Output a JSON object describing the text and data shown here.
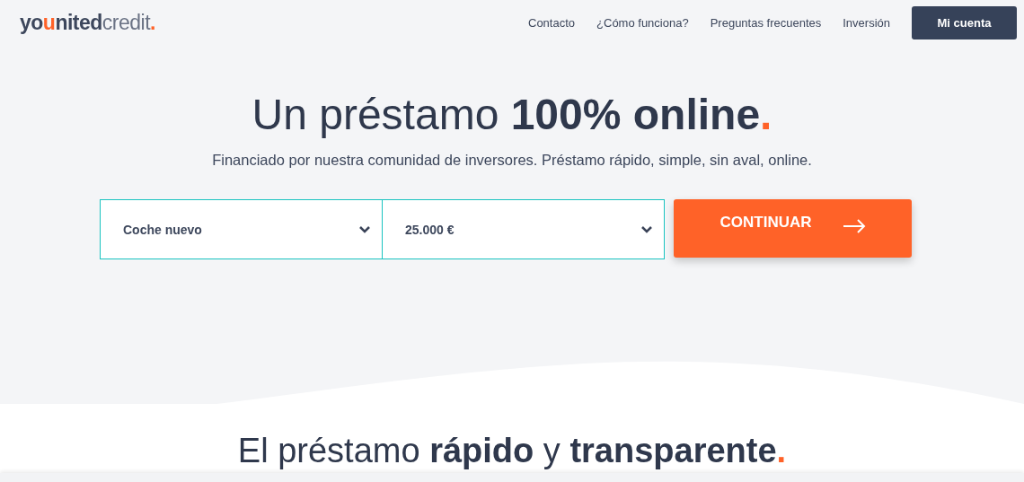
{
  "logo": {
    "parts": [
      {
        "text": "yo",
        "accent": false
      },
      {
        "text": "u",
        "accent": true
      },
      {
        "text": "nited",
        "accent": false
      }
    ],
    "suffix": "credit",
    "dot": "."
  },
  "nav": {
    "links": [
      "Contacto",
      "¿Cómo funciona?",
      "Preguntas frecuentes",
      "Inversión"
    ],
    "account_button": "Mi cuenta"
  },
  "hero": {
    "title": "Un préstamo **100% online**",
    "title_dot": ".",
    "subtitle": "Financiado por nuestra comunidad de inversores. Préstamo rápido, simple, sin aval, online.",
    "selects": [
      {
        "value": "Coche nuevo"
      },
      {
        "value": "25.000 €"
      }
    ],
    "continue_button": "CONTINUAR"
  },
  "section": {
    "title": "El préstamo **rápido** y **transparente**",
    "title_dot": "."
  }
}
